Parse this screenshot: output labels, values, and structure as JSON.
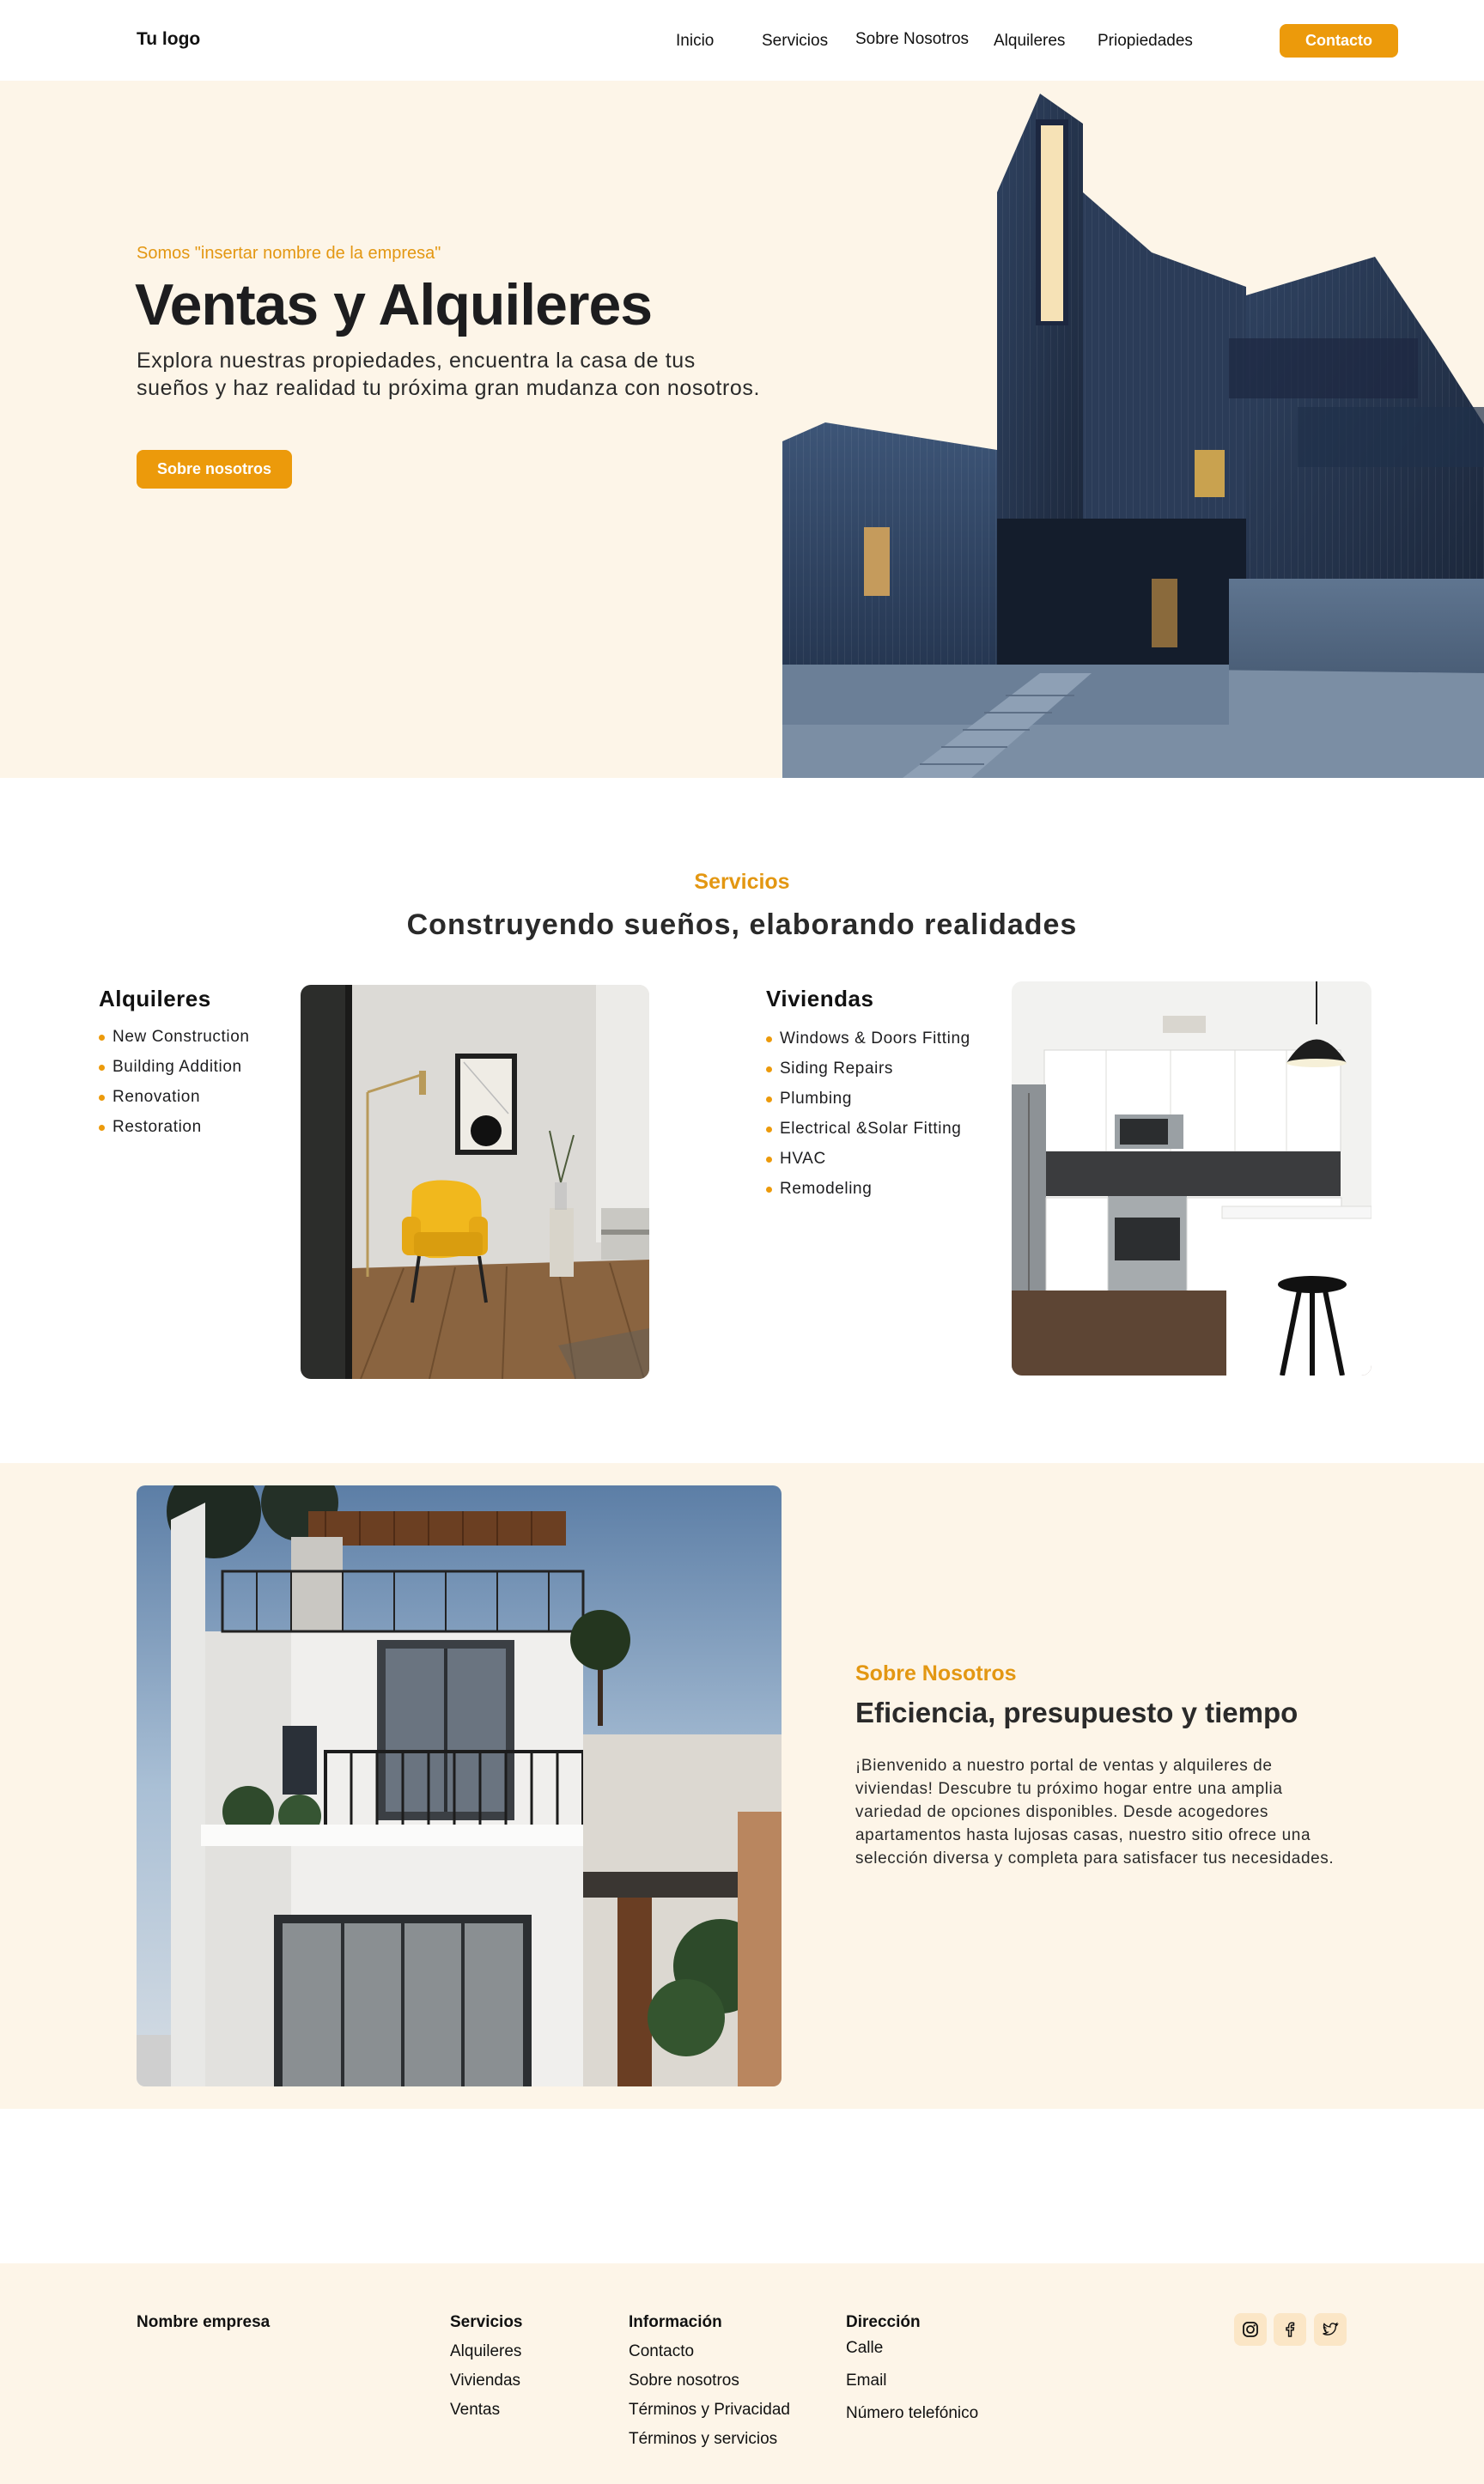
{
  "nav": {
    "logo": "Tu logo",
    "links": [
      "Inicio",
      "Servicios",
      "Sobre Nosotros",
      "Alquileres",
      "Priopiedades"
    ],
    "cta": "Contacto"
  },
  "hero": {
    "eyebrow": "Somos \"insertar nombre de la empresa\"",
    "title": "Ventas y Alquileres",
    "description": "Explora nuestras propiedades, encuentra la casa de tus sueños y haz realidad tu próxima gran mudanza con nosotros.",
    "button": "Sobre nosotros"
  },
  "services": {
    "eyebrow": "Servicios",
    "title": "Construyendo sueños, elaborando realidades",
    "rentals": {
      "heading": "Alquileres",
      "items": [
        "New Construction",
        "Building Addition",
        "Renovation",
        "Restoration"
      ]
    },
    "homes": {
      "heading": "Viviendas",
      "items": [
        "Windows & Doors Fitting",
        "Siding Repairs",
        "Plumbing",
        "Electrical &Solar Fitting",
        "HVAC",
        "Remodeling"
      ]
    }
  },
  "about": {
    "eyebrow": "Sobre Nosotros",
    "title": "Eficiencia, presupuesto y tiempo",
    "text": "¡Bienvenido a nuestro portal de ventas y alquileres de viviendas! Descubre tu próximo hogar entre una amplia variedad de opciones disponibles. Desde acogedores apartamentos hasta lujosas casas, nuestro sitio ofrece una selección diversa y completa para satisfacer tus necesidades."
  },
  "footer": {
    "company": "Nombre empresa",
    "services": {
      "heading": "Servicios",
      "links": [
        "Alquileres",
        "Viviendas",
        "Ventas"
      ]
    },
    "info": {
      "heading": "Información",
      "links": [
        "Contacto",
        "Sobre nosotros",
        "Términos y Privacidad",
        "Términos y servicios"
      ]
    },
    "address": {
      "heading": "Dirección",
      "lines": [
        "Calle",
        "Email",
        "Número telefónico"
      ]
    },
    "social": [
      "instagram-icon",
      "facebook-icon",
      "twitter-icon"
    ]
  },
  "colors": {
    "accent": "#ec9a0b",
    "cream": "#fdf5e8",
    "text": "#1d1d1f"
  }
}
